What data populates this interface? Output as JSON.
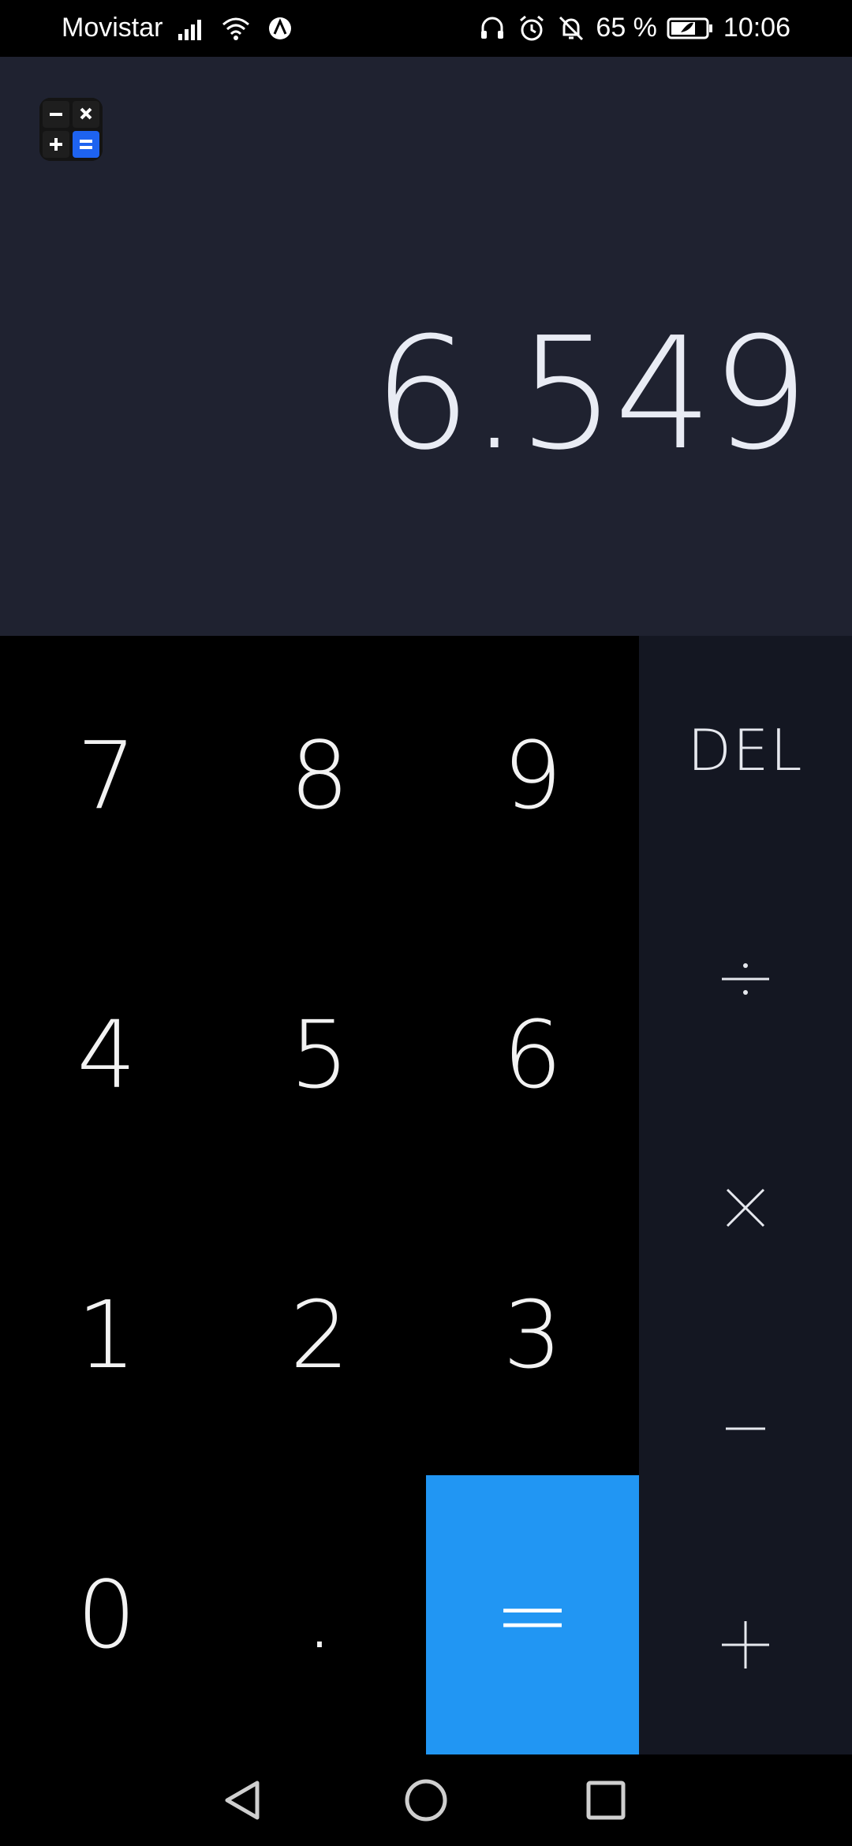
{
  "status_bar": {
    "carrier": "Movistar",
    "battery": "65 %",
    "time": "10:06",
    "icons_left": [
      "signal-icon",
      "wifi-icon",
      "vpn-icon"
    ],
    "icons_right": [
      "headphones-icon",
      "alarm-icon",
      "bell-off-icon",
      "battery-icon"
    ]
  },
  "display": {
    "value": "6.549"
  },
  "keypad": {
    "keys": {
      "k7": "7",
      "k8": "8",
      "k9": "9",
      "k4": "4",
      "k5": "5",
      "k6": "6",
      "k1": "1",
      "k2": "2",
      "k3": "3",
      "k0": "0",
      "dot": ".",
      "equals": "="
    }
  },
  "operators": {
    "del": "DEL",
    "divide": "÷",
    "multiply": "×",
    "subtract": "−",
    "add": "+"
  },
  "colors": {
    "display_bg": "#1f2230",
    "ops_bg": "#141722",
    "equals_bg": "#2196f3"
  },
  "nav": [
    "back-icon",
    "home-icon",
    "recents-icon"
  ]
}
